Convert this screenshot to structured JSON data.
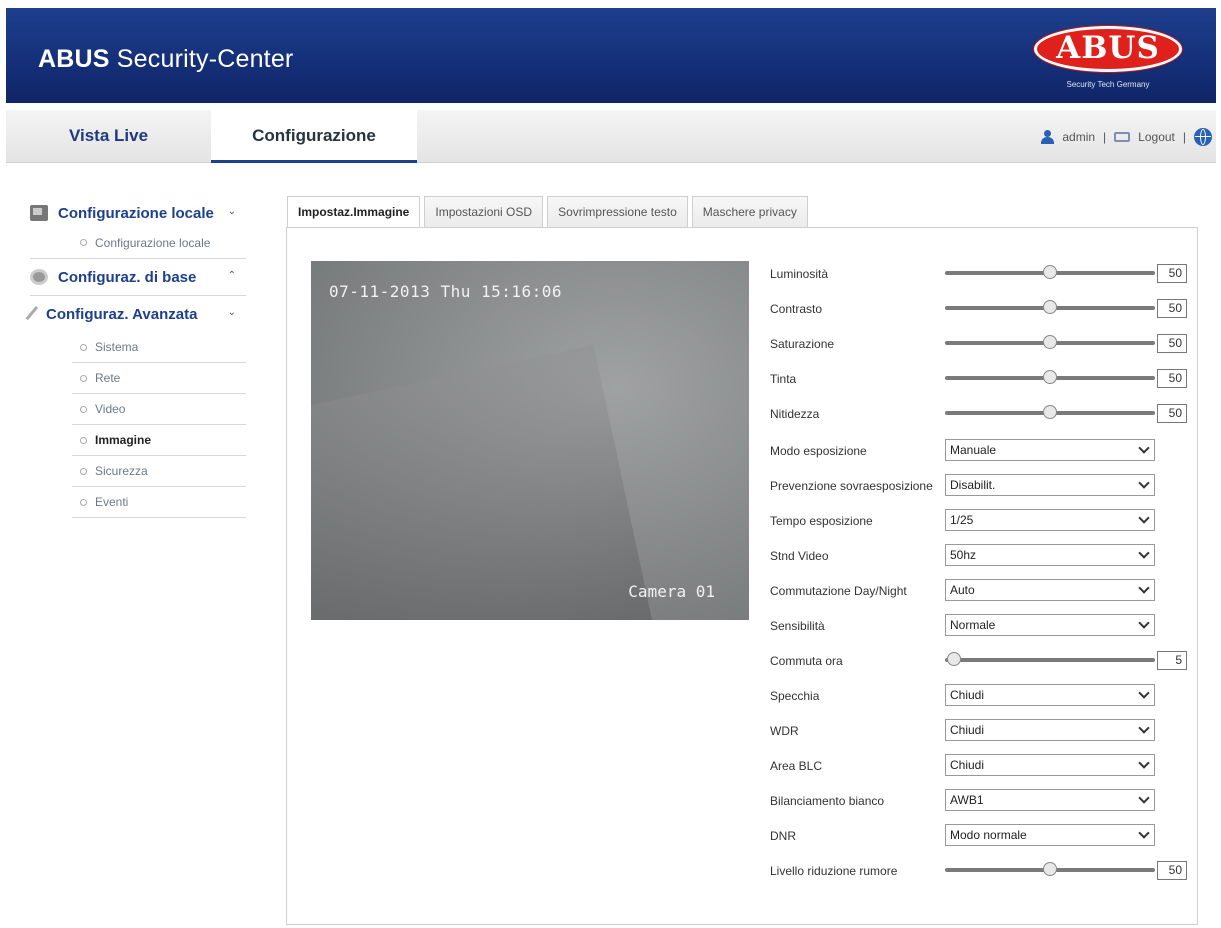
{
  "header": {
    "app_title_bold": "ABUS",
    "app_title_rest": " Security-Center",
    "logo_text": "ABUS",
    "logo_sub": "Security Tech Germany",
    "brand_color": "#1e3f8c",
    "logo_color": "#e0201b"
  },
  "nav": {
    "tabs": [
      {
        "label": "Vista Live"
      },
      {
        "label": "Configurazione",
        "active": true
      }
    ],
    "user": "admin",
    "sep": "|",
    "logout": "Logout"
  },
  "sidebar": {
    "sections": [
      {
        "label": "Configurazione locale",
        "chevron": "⌄",
        "icon": "monitor-icon",
        "items": [
          {
            "label": "Configurazione locale"
          }
        ]
      },
      {
        "label": "Configuraz. di base",
        "chevron": "⌃",
        "icon": "gear-icon",
        "items": []
      },
      {
        "label": "Configuraz. Avanzata",
        "chevron": "⌄",
        "icon": "wrench-icon",
        "items": [
          {
            "label": "Sistema"
          },
          {
            "label": "Rete"
          },
          {
            "label": "Video"
          },
          {
            "label": "Immagine",
            "active": true
          },
          {
            "label": "Sicurezza"
          },
          {
            "label": "Eventi"
          }
        ]
      }
    ]
  },
  "content_tabs": [
    {
      "label": "Impostaz.Immagine",
      "active": true
    },
    {
      "label": "Impostazioni OSD"
    },
    {
      "label": "Sovrimpressione testo"
    },
    {
      "label": "Maschere privacy"
    }
  ],
  "video": {
    "timestamp": "07-11-2013 Thu 15:16:06",
    "camera_name": "Camera 01"
  },
  "settings": [
    {
      "label": "Luminosità",
      "type": "slider",
      "value": 50,
      "max": 100
    },
    {
      "label": "Contrasto",
      "type": "slider",
      "value": 50,
      "max": 100
    },
    {
      "label": "Saturazione",
      "type": "slider",
      "value": 50,
      "max": 100
    },
    {
      "label": "Tinta",
      "type": "slider",
      "value": 50,
      "max": 100
    },
    {
      "label": "Nitidezza",
      "type": "slider",
      "value": 50,
      "max": 100
    },
    {
      "label": "Modo esposizione",
      "type": "select",
      "value": "Manuale"
    },
    {
      "label": "Prevenzione sovraesposizione",
      "type": "select",
      "value": "Disabilit."
    },
    {
      "label": "Tempo esposizione",
      "type": "select",
      "value": "1/25"
    },
    {
      "label": "Stnd Video",
      "type": "select",
      "value": "50hz"
    },
    {
      "label": "Commutazione Day/Night",
      "type": "select",
      "value": "Auto"
    },
    {
      "label": "Sensibilità",
      "type": "select",
      "value": "Normale"
    },
    {
      "label": "Commuta ora",
      "type": "slider",
      "value": 5,
      "max": 120
    },
    {
      "label": "Specchia",
      "type": "select",
      "value": "Chiudi"
    },
    {
      "label": "WDR",
      "type": "select",
      "value": "Chiudi"
    },
    {
      "label": "Area BLC",
      "type": "select",
      "value": "Chiudi"
    },
    {
      "label": "Bilanciamento bianco",
      "type": "select",
      "value": "AWB1"
    },
    {
      "label": "DNR",
      "type": "select",
      "value": "Modo normale"
    },
    {
      "label": "Livello riduzione rumore",
      "type": "slider",
      "value": 50,
      "max": 100
    }
  ]
}
